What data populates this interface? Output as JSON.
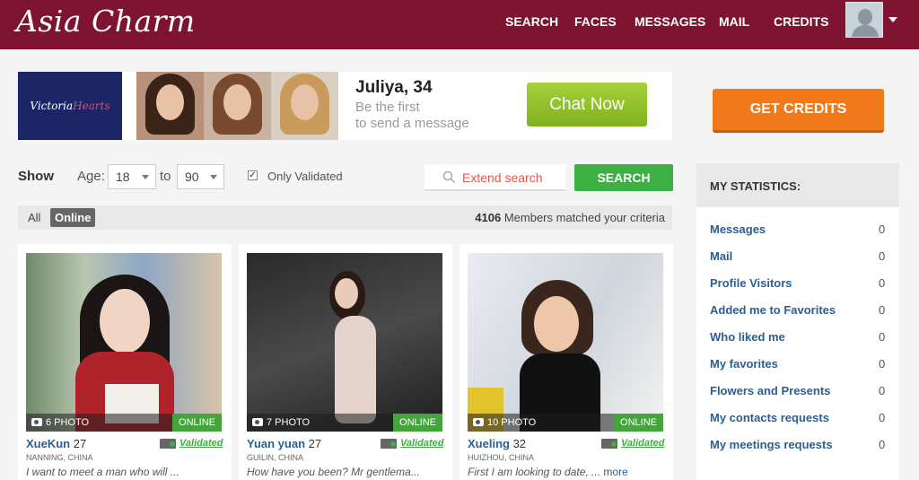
{
  "header": {
    "logo": "Asia Charm",
    "nav": [
      "SEARCH",
      "FACES",
      "MESSAGES",
      "MAIL",
      "CREDITS"
    ]
  },
  "ad": {
    "brand_part1": "Victoria",
    "brand_part2": "Hearts",
    "name": "Juliya, 34",
    "line1": "Be the first",
    "line2": "to send a message",
    "button": "Chat Now"
  },
  "filters": {
    "show": "Show",
    "age": "Age:",
    "age_from": "18",
    "to": "to",
    "age_to": "90",
    "only_validated": "Only Validated",
    "only_validated_checked": true,
    "extend_search": "Extend search",
    "search_button": "SEARCH"
  },
  "results": {
    "tab_all": "All",
    "tab_online": "Online",
    "count": "4106",
    "count_text": "Members matched your criteria"
  },
  "profiles": [
    {
      "name": "XueKun",
      "age": "27",
      "photos": "6 PHOTO",
      "status": "ONLINE",
      "validated": "Validated",
      "location": "NANNING, CHINA",
      "message": "I want to meet a man who will ...",
      "more": ""
    },
    {
      "name": "Yuan yuan",
      "age": "27",
      "photos": "7 PHOTO",
      "status": "ONLINE",
      "validated": "Validated",
      "location": "GUILIN, CHINA",
      "message": "How have you been? Mr gentlema...",
      "more": ""
    },
    {
      "name": "Xueling",
      "age": "32",
      "photos": "10 PHOTO",
      "status": "ONLINE",
      "validated": "Validated",
      "location": "HUIZHOU, CHINA",
      "message": "First I am looking to date, ...",
      "more": "more"
    }
  ],
  "sidebar": {
    "get_credits": "GET CREDITS",
    "stats_title": "MY STATISTICS:",
    "stats": [
      {
        "label": "Messages",
        "count": "0"
      },
      {
        "label": "Mail",
        "count": "0"
      },
      {
        "label": "Profile Visitors",
        "count": "0"
      },
      {
        "label": "Added me to Favorites",
        "count": "0"
      },
      {
        "label": "Who liked me",
        "count": "0"
      },
      {
        "label": "My favorites",
        "count": "0"
      },
      {
        "label": "Flowers and Presents",
        "count": "0"
      },
      {
        "label": "My contacts requests",
        "count": "0"
      },
      {
        "label": "My meetings requests",
        "count": "0"
      }
    ]
  },
  "colors": {
    "header": "#7e1431",
    "chat_button": "#8cc12b",
    "get_credits": "#f07a1a",
    "search_button": "#3cb043",
    "link": "#2b5e91"
  }
}
